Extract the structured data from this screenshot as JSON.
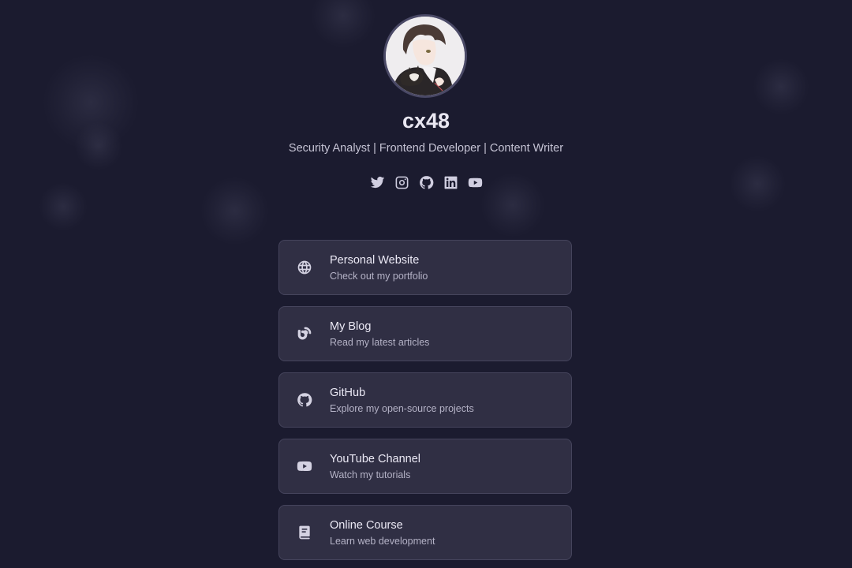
{
  "profile": {
    "name": "cx48",
    "tagline": "Security Analyst | Frontend Developer | Content Writer"
  },
  "social_icons": [
    {
      "name": "twitter-icon"
    },
    {
      "name": "instagram-icon"
    },
    {
      "name": "github-icon"
    },
    {
      "name": "linkedin-icon"
    },
    {
      "name": "youtube-icon"
    }
  ],
  "links": [
    {
      "title": "Personal Website",
      "description": "Check out my portfolio",
      "icon": "globe-icon"
    },
    {
      "title": "My Blog",
      "description": "Read my latest articles",
      "icon": "blog-icon"
    },
    {
      "title": "GitHub",
      "description": "Explore my open-source projects",
      "icon": "github-icon"
    },
    {
      "title": "YouTube Channel",
      "description": "Watch my tutorials",
      "icon": "youtube-icon"
    },
    {
      "title": "Online Course",
      "description": "Learn web development",
      "icon": "book-icon"
    }
  ],
  "colors": {
    "background": "#1b1b2f",
    "card": "#302f44",
    "card_border": "#45445c",
    "text_primary": "#ebe9f5",
    "text_secondary": "#b4b2c6"
  }
}
